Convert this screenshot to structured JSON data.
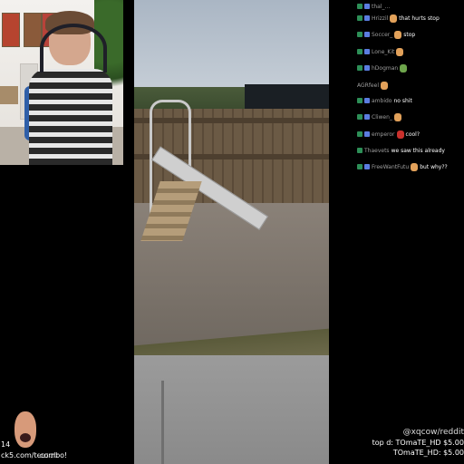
{
  "chat": {
    "messages": [
      {
        "user": "thal_...",
        "text": ""
      },
      {
        "user": "Hrizzil",
        "text": "that hurts stop"
      },
      {
        "user": "Soccer_",
        "text": "stop"
      },
      {
        "user": "Lone_Kit",
        "text": ""
      },
      {
        "user": "hDogman",
        "text": ""
      },
      {
        "user": "AGRfeel",
        "text": ""
      },
      {
        "user": "ambido",
        "text": "no shit"
      },
      {
        "user": "Cliwen_",
        "text": ""
      },
      {
        "user": "emperor",
        "text": "cool?"
      },
      {
        "user": "Thaevets",
        "text": "we saw this already"
      },
      {
        "user": "FreeWantFutu",
        "text": "but why??"
      }
    ]
  },
  "overlay": {
    "alert_count": "14",
    "alert_text": "ck5.com/teeseb",
    "alert_sub": "combo!"
  },
  "donations": {
    "line1": "top d: TOmaTE_HD $5.00",
    "line2": "TOmaTE_HD: $5.00",
    "watermark": "@xqcow/reddit"
  }
}
